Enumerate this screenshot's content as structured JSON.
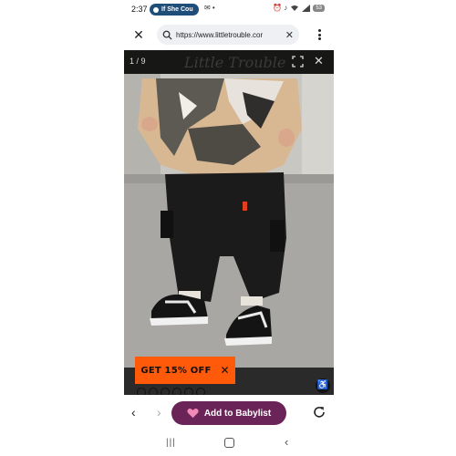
{
  "status_bar": {
    "time": "2:37",
    "notification_pill": "If She Cou",
    "left_icons": "✉ •",
    "right_icons": "⏰ ♪",
    "battery": "53"
  },
  "url_bar": {
    "url": "https://www.littletrouble.cor"
  },
  "viewer": {
    "counter": "1 / 9",
    "watermark": "Little Trouble"
  },
  "promo": {
    "label": "GET 15% OFF",
    "close": "✕"
  },
  "toolbar": {
    "back": "‹",
    "forward": "›",
    "babylist_label": "Add to Babylist"
  },
  "system_nav": {
    "recents": "|||",
    "back": "‹"
  },
  "icons": {
    "close": "close-icon",
    "search": "search-icon",
    "menu": "more-vert-icon",
    "expand": "expand-icon",
    "accessibility": "accessibility-icon",
    "heart": "heart-icon",
    "reload": "reload-icon"
  },
  "colors": {
    "promo_bg": "#ff5a0a",
    "babylist_bg": "#6b2458",
    "pill_bg": "#1f4e79"
  }
}
